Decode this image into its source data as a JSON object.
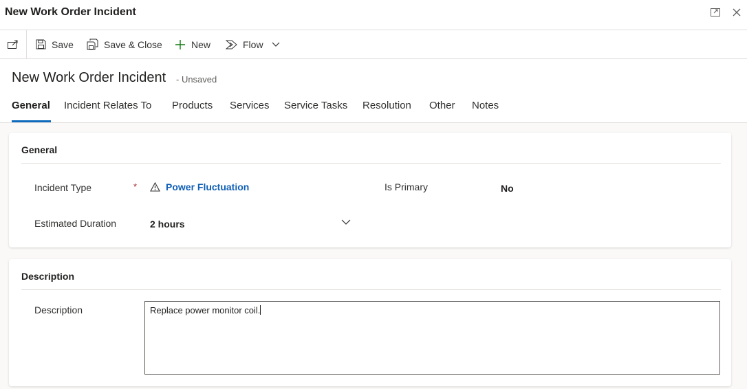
{
  "window": {
    "title": "New Work Order Incident"
  },
  "commands": {
    "save": "Save",
    "save_close": "Save & Close",
    "new": "New",
    "flow": "Flow"
  },
  "record": {
    "title": "New Work Order Incident",
    "status": "- Unsaved"
  },
  "tabs": [
    {
      "label": "General",
      "active": true
    },
    {
      "label": "Incident Relates To"
    },
    {
      "label": "Products"
    },
    {
      "label": "Services"
    },
    {
      "label": "Service Tasks"
    },
    {
      "label": "Resolution"
    },
    {
      "label": "Other"
    },
    {
      "label": "Notes"
    }
  ],
  "general": {
    "title": "General",
    "incident_type": {
      "label": "Incident Type",
      "required_marker": "*",
      "value": "Power Fluctuation"
    },
    "is_primary": {
      "label": "Is Primary",
      "value": "No"
    },
    "estimated_duration": {
      "label": "Estimated Duration",
      "value": "2 hours"
    }
  },
  "description": {
    "title": "Description",
    "label": "Description",
    "value": "Replace power monitor coil."
  },
  "colors": {
    "accent": "#0f6cbd",
    "link": "#1160b7",
    "required": "#a4262c"
  }
}
